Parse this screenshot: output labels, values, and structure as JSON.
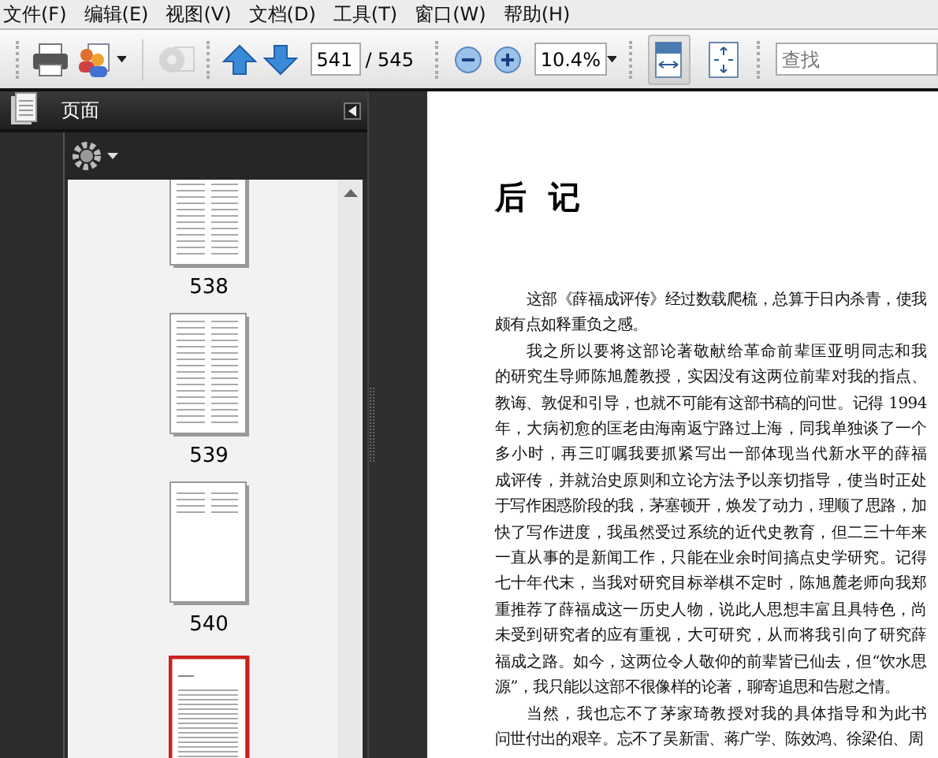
{
  "menu": [
    "文件(F)",
    "编辑(E)",
    "视图(V)",
    "文档(D)",
    "工具(T)",
    "窗口(W)",
    "帮助(H)"
  ],
  "toolbar": {
    "page_field": {
      "value": "541"
    },
    "page_total": "/ 545",
    "zoom_field": {
      "value": "10.4%"
    },
    "view_buttons": [
      {
        "kind": "fit-width",
        "selected": true
      },
      {
        "kind": "fit-page",
        "selected": false
      }
    ],
    "search": {
      "placeholder": "查找"
    },
    "share_disabled": true
  },
  "pages_panel": {
    "title": "页面",
    "thumbnails": [
      {
        "label": "538",
        "kind": "two-column",
        "selected": false
      },
      {
        "label": "539",
        "kind": "two-column",
        "selected": false
      },
      {
        "label": "540",
        "kind": "short",
        "selected": false
      },
      {
        "kind": "text",
        "selected": true
      }
    ]
  },
  "document": {
    "title": "后  记",
    "paragraphs": [
      [
        "这部《薛福成评传》经过数载爬梳，总算于日内杀青，使我",
        "颇有点如释重负之感。"
      ],
      [
        "我之所以要将这部论著敬献给革命前辈匡亚明同志和我",
        "的研究生导师陈旭麓教授，实因没有这两位前辈对我的指点、",
        "教诲、敦促和引导，也就不可能有这部书稿的问世。记得 1994",
        "年，大病初愈的匡老由海南返宁路过上海，同我单独谈了一个",
        "多小时，再三叮嘱我要抓紧写出一部体现当代新水平的薛福",
        "成评传，并就治史原则和立论方法予以亲切指导，使当时正处",
        "于写作困惑阶段的我，茅塞顿开，焕发了动力，理顺了思路，加",
        "快了写作进度，我虽然受过系统的近代史教育，但二三十年来",
        "一直从事的是新闻工作，只能在业余时间搞点史学研究。记得",
        "七十年代末，当我对研究目标举棋不定时，陈旭麓老师向我郑",
        "重推荐了薛福成这一历史人物，说此人思想丰富且具特色，尚",
        "未受到研究者的应有重视，大可研究，从而将我引向了研究薛",
        "福成之路。如今，这两位令人敬仰的前辈皆已仙去，但“饮水思",
        "源”，我只能以这部不很像样的论著，聊寄追思和告慰之情。"
      ],
      [
        "当然，我也忘不了茅家琦教授对我的具体指导和为此书",
        "问世付出的艰辛。忘不了吴新雷、蒋广学、陈效鸿、徐梁伯、周"
      ]
    ]
  }
}
